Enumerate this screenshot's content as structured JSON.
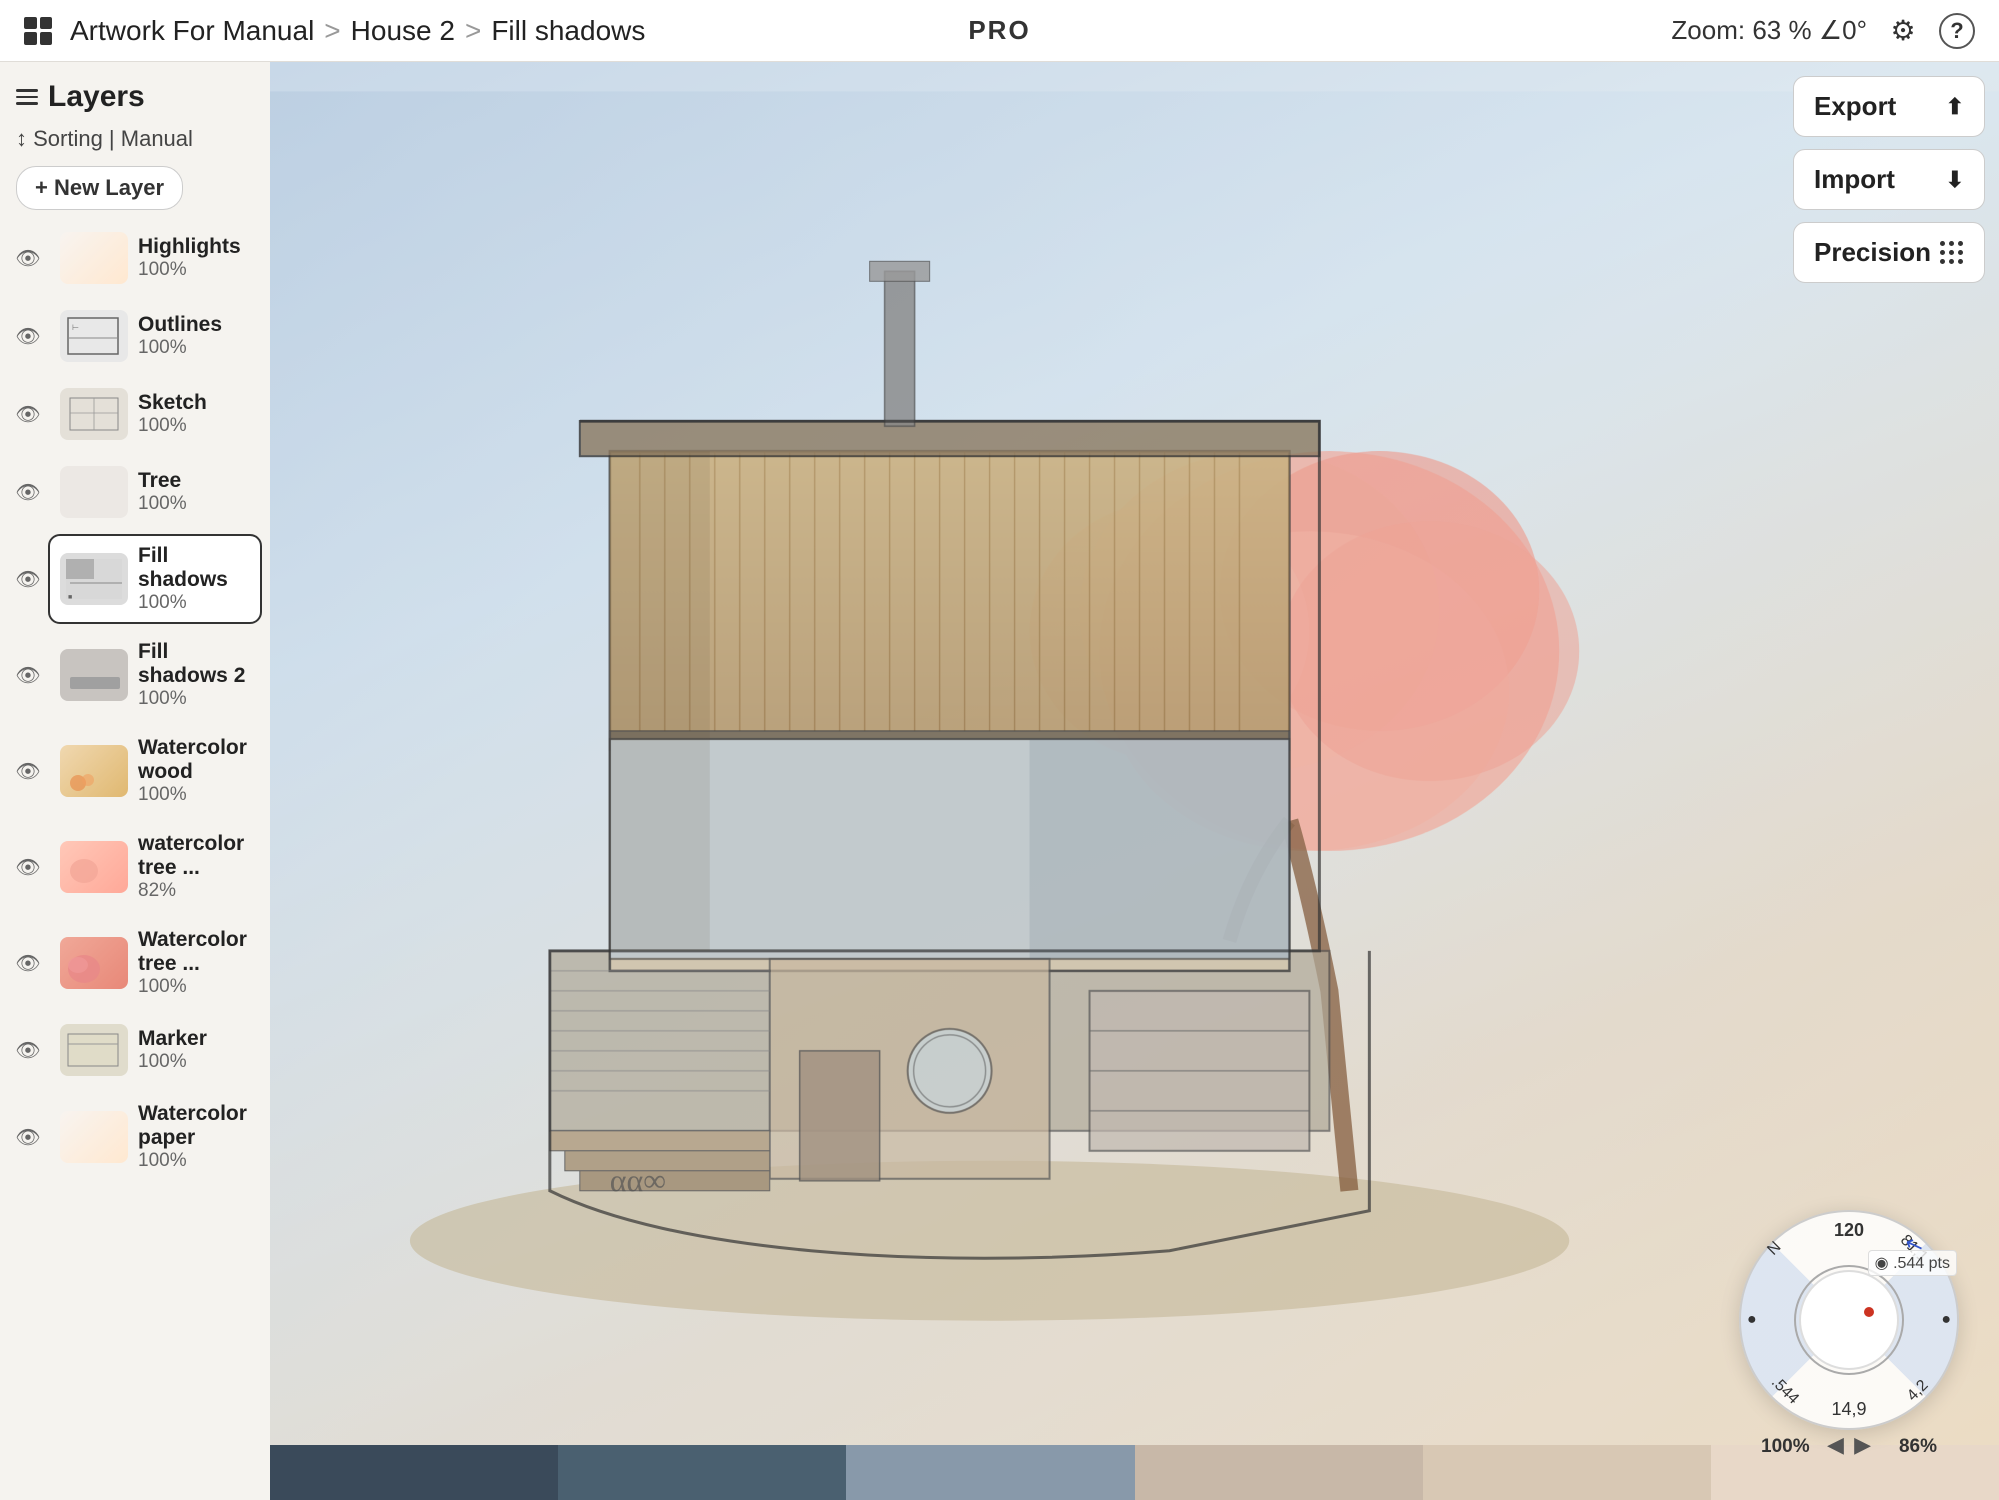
{
  "topbar": {
    "grid_icon": "grid-icon",
    "breadcrumb": {
      "part1": "Artwork For Manual",
      "sep1": ">",
      "part2": "House 2",
      "sep2": ">",
      "part3": "Fill shadows"
    },
    "pro": "PRO",
    "zoom_label": "Zoom:",
    "zoom_value": "63 %",
    "zoom_angle": "∠0°",
    "gear_icon": "gear",
    "help_icon": "?"
  },
  "sidebar": {
    "title": "Layers",
    "sorting": "↕ Sorting | Manual",
    "new_layer": "+ New Layer",
    "layers": [
      {
        "name": "Highlights",
        "opacity": "100%",
        "thumb": "highlights",
        "visible": true,
        "active": false
      },
      {
        "name": "Outlines",
        "opacity": "100%",
        "thumb": "outlines",
        "visible": true,
        "active": false
      },
      {
        "name": "Sketch",
        "opacity": "100%",
        "thumb": "sketch",
        "visible": true,
        "active": false
      },
      {
        "name": "Tree",
        "opacity": "100%",
        "thumb": "tree",
        "visible": true,
        "active": false
      },
      {
        "name": "Fill shadows",
        "opacity": "100%",
        "thumb": "fillshadow",
        "visible": true,
        "active": true
      },
      {
        "name": "Fill shadows 2",
        "opacity": "100%",
        "thumb": "fillshadow2",
        "visible": true,
        "active": false
      },
      {
        "name": "Watercolor wood",
        "opacity": "100%",
        "thumb": "wcwood",
        "visible": true,
        "active": false
      },
      {
        "name": "watercolor tree ...",
        "opacity": "82%",
        "thumb": "wctree",
        "visible": true,
        "active": false
      },
      {
        "name": "Watercolor tree ...",
        "opacity": "100%",
        "thumb": "wctree2",
        "visible": true,
        "active": false
      },
      {
        "name": "Marker",
        "opacity": "100%",
        "thumb": "marker",
        "visible": true,
        "active": false
      },
      {
        "name": "Watercolor paper",
        "opacity": "100%",
        "thumb": "highlights",
        "visible": true,
        "active": false
      }
    ]
  },
  "right_panel": {
    "export_label": "Export",
    "import_label": "Import",
    "precision_label": "Precision"
  },
  "wheel": {
    "pts": "◉ .544 pts",
    "inner_label_100": "100%",
    "inner_label_86": "86%",
    "ticks": [
      "120",
      "81,1",
      ".544",
      "N",
      "14,9",
      "4,2"
    ]
  },
  "colors": [
    "#3a4a5a",
    "#4a6070",
    "#8899aa",
    "#c8b8a8",
    "#d8c8b4",
    "#e8d8c8"
  ]
}
